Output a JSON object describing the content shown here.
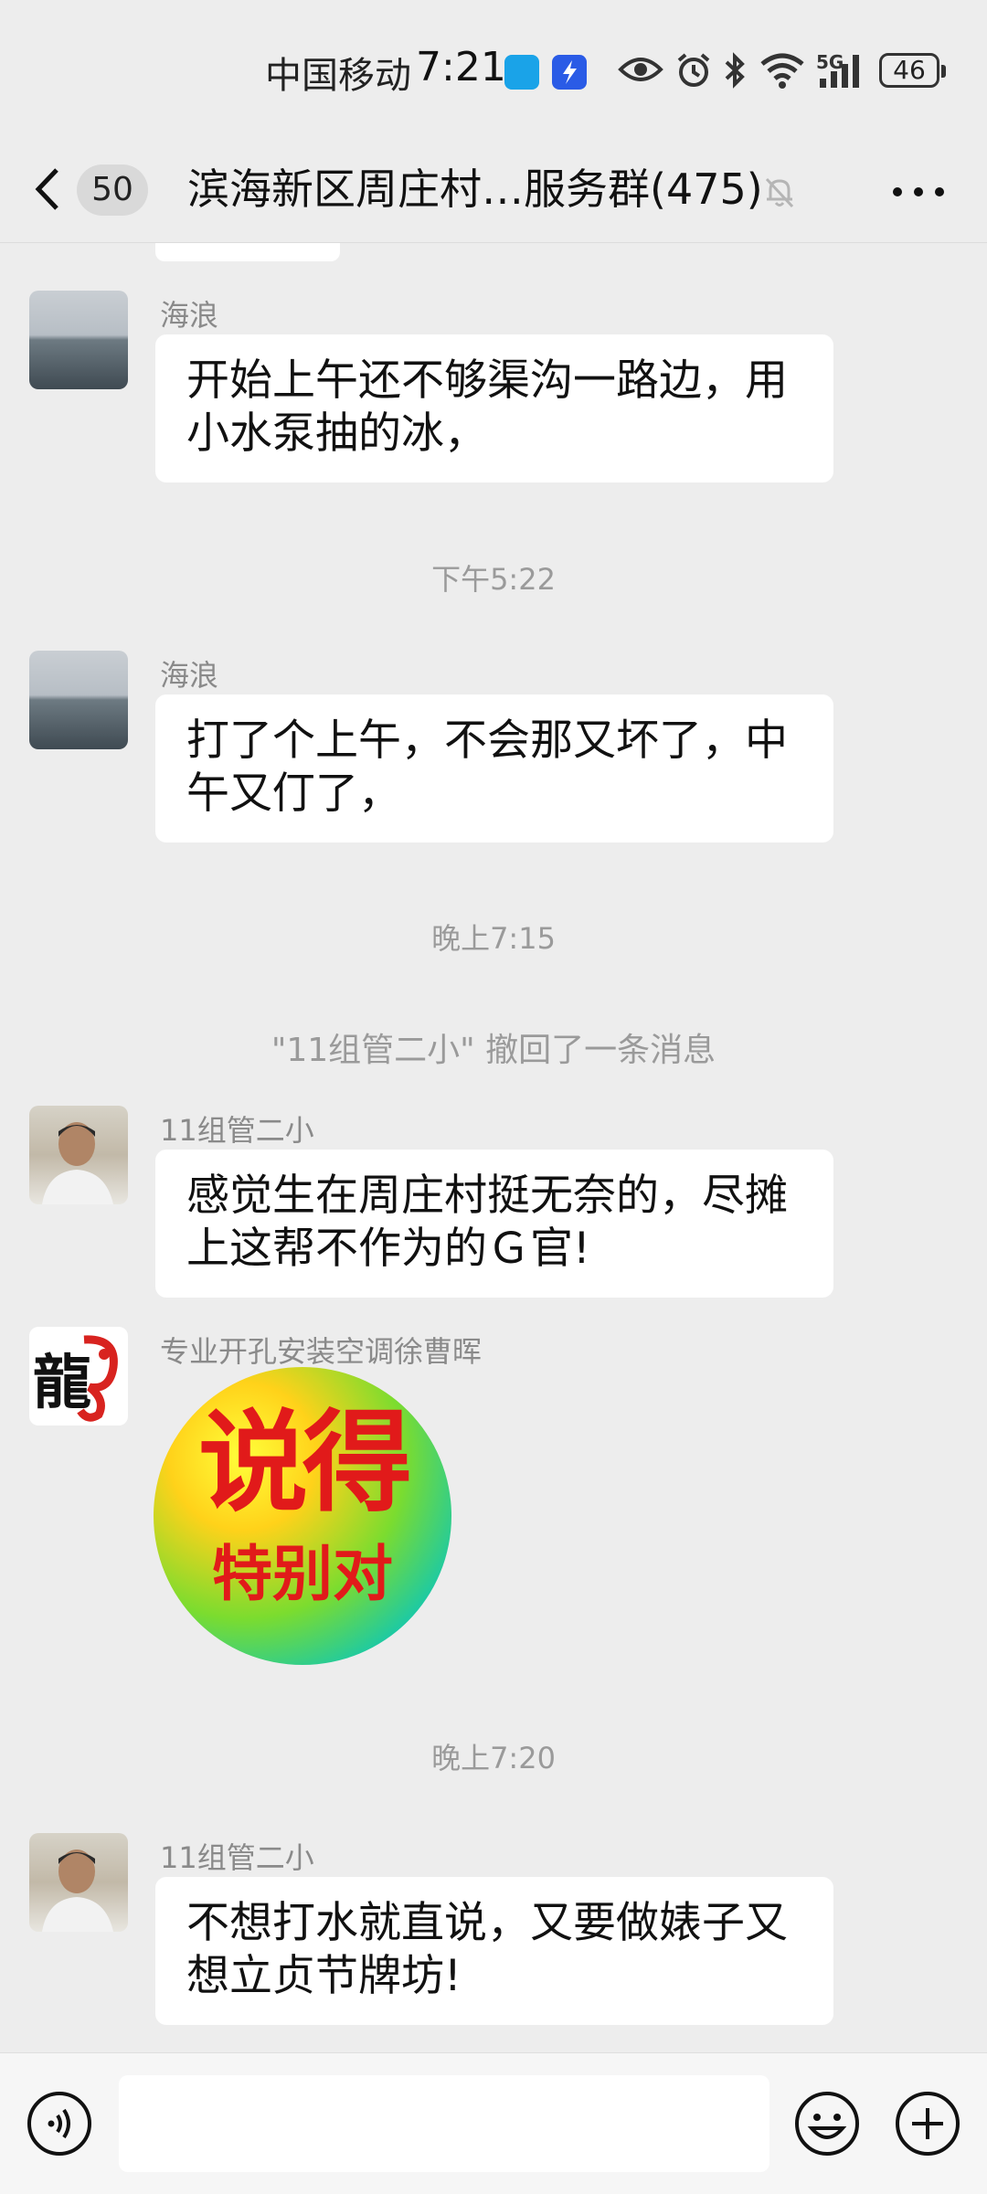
{
  "status_bar": {
    "carrier": "中国移动",
    "time": "7:21",
    "network": "5G",
    "battery": "46"
  },
  "header": {
    "unread_count": "50",
    "title": "滨海新区周庄村…服务群(475)"
  },
  "chat": {
    "messages": [
      {
        "sender": "海浪",
        "text": "开始上午还不够渠沟一路边，用小水泵抽的冰，"
      },
      {
        "time": "下午5:22"
      },
      {
        "sender": "海浪",
        "text": "打了个上午，不会那又坏了，中午又仃了，"
      },
      {
        "time": "晚上7:15"
      },
      {
        "system": "\"11组管二小\" 撤回了一条消息"
      },
      {
        "sender": "11组管二小",
        "text": "感觉生在周庄村挺无奈的，尽摊上这帮不作为的Ｇ官!"
      },
      {
        "sender": "专业开孔安装空调徐曹晖",
        "sticker_line1": "说得",
        "sticker_line2": "特别对",
        "avatar_glyph": "龍"
      },
      {
        "time": "晚上7:20"
      },
      {
        "sender": "11组管二小",
        "text": "不想打水就直说，又要做婊子又想立贞节牌坊!"
      }
    ]
  },
  "colors": {
    "background": "#ededed",
    "bubble": "#ffffff",
    "sticker_text": "#e11a1a"
  },
  "icons": [
    "back-arrow-icon",
    "mute-bell-icon",
    "more-icon",
    "voice-icon",
    "emoji-icon",
    "plus-icon"
  ]
}
